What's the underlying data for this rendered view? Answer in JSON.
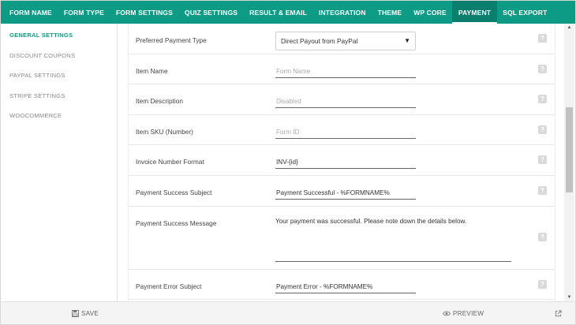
{
  "nav": {
    "tabs": [
      {
        "label": "FORM NAME"
      },
      {
        "label": "FORM TYPE"
      },
      {
        "label": "FORM SETTINGS"
      },
      {
        "label": "QUIZ SETTINGS"
      },
      {
        "label": "RESULT & EMAIL"
      },
      {
        "label": "INTEGRATION"
      },
      {
        "label": "THEME"
      },
      {
        "label": "WP CORE"
      },
      {
        "label": "PAYMENT"
      },
      {
        "label": "SQL EXPORT"
      }
    ],
    "active": "PAYMENT"
  },
  "sidebar": {
    "items": [
      {
        "label": "GENERAL SETTINGS"
      },
      {
        "label": "DISCOUNT COUPONS"
      },
      {
        "label": "PAYPAL SETTINGS"
      },
      {
        "label": "STRIPE SETTINGS"
      },
      {
        "label": "WOOCOMMERCE"
      }
    ],
    "active": "GENERAL SETTINGS"
  },
  "form": {
    "payment_type": {
      "label": "Preferred Payment Type",
      "value": "Direct Payout from PayPal"
    },
    "item_name": {
      "label": "Item Name",
      "placeholder": "Form Name"
    },
    "item_description": {
      "label": "Item Description",
      "placeholder": "Disabled"
    },
    "item_sku": {
      "label": "Item SKU (Number)",
      "placeholder": "Form ID"
    },
    "invoice_format": {
      "label": "Invoice Number Format",
      "value": "INV-{id}"
    },
    "success_subject": {
      "label": "Payment Success Subject",
      "value": "Payment Successful - %FORMNAME%"
    },
    "success_message": {
      "label": "Payment Success Message",
      "value": "Your payment was successful. Please note down the details below."
    },
    "error_subject": {
      "label": "Payment Error Subject",
      "value": "Payment Error - %FORMNAME%"
    }
  },
  "footer": {
    "save_label": "SAVE",
    "preview_label": "PREVIEW"
  },
  "colors": {
    "accent": "#0d9b86",
    "nav_active": "#0a7f6e"
  },
  "icons": {
    "help": "help-icon",
    "save": "floppy-disk-icon",
    "preview": "eye-icon",
    "external": "external-link-icon"
  }
}
